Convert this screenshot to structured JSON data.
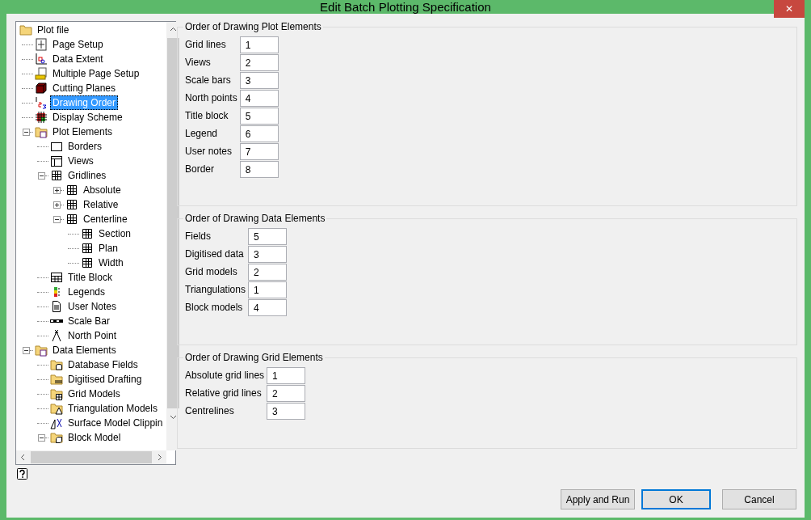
{
  "window": {
    "title": "Edit Batch Plotting Specification",
    "close": "✕"
  },
  "tree": {
    "items": [
      {
        "label": "Plot file",
        "kind": "folder",
        "selected": false,
        "children": [
          {
            "label": "Page Setup",
            "kind": "page",
            "selected": false
          },
          {
            "label": "Data Extent",
            "kind": "extent",
            "selected": false
          },
          {
            "label": "Multiple Page Setup",
            "kind": "multipage",
            "selected": false
          },
          {
            "label": "Cutting Planes",
            "kind": "cube",
            "selected": false
          },
          {
            "label": "Drawing Order",
            "kind": "order",
            "selected": true
          },
          {
            "label": "Display Scheme",
            "kind": "scheme",
            "selected": false
          },
          {
            "label": "Plot Elements",
            "kind": "folder-doc",
            "selected": false,
            "expanded": true,
            "children": [
              {
                "label": "Borders",
                "kind": "border",
                "selected": false
              },
              {
                "label": "Views",
                "kind": "views",
                "selected": false
              },
              {
                "label": "Gridlines",
                "kind": "grid",
                "selected": false,
                "expanded": true,
                "children": [
                  {
                    "label": "Absolute",
                    "kind": "grid",
                    "selected": false,
                    "expanded": false
                  },
                  {
                    "label": "Relative",
                    "kind": "grid",
                    "selected": false,
                    "expanded": false
                  },
                  {
                    "label": "Centerline",
                    "kind": "grid",
                    "selected": false,
                    "expanded": true,
                    "children": [
                      {
                        "label": "Section",
                        "kind": "grid",
                        "selected": false
                      },
                      {
                        "label": "Plan",
                        "kind": "grid",
                        "selected": false
                      },
                      {
                        "label": "Width",
                        "kind": "grid",
                        "selected": false
                      }
                    ]
                  }
                ]
              },
              {
                "label": "Title Block",
                "kind": "titleblock",
                "selected": false
              },
              {
                "label": "Legends",
                "kind": "legend",
                "selected": false
              },
              {
                "label": "User Notes",
                "kind": "notes",
                "selected": false
              },
              {
                "label": "Scale Bar",
                "kind": "scalebar",
                "selected": false
              },
              {
                "label": "North Point",
                "kind": "north",
                "selected": false
              }
            ]
          },
          {
            "label": "Data Elements",
            "kind": "folder-doc",
            "selected": false,
            "expanded": true,
            "children": [
              {
                "label": "Database Fields",
                "kind": "folder-db",
                "selected": false
              },
              {
                "label": "Digitised Drafting",
                "kind": "folder-draft",
                "selected": false
              },
              {
                "label": "Grid Models",
                "kind": "folder-grid",
                "selected": false
              },
              {
                "label": "Triangulation Models",
                "kind": "folder-tri",
                "selected": false
              },
              {
                "label": "Surface Model Clippin",
                "kind": "clip",
                "selected": false
              },
              {
                "label": "Block Model",
                "kind": "folder-block",
                "selected": false,
                "expanded": true
              }
            ]
          }
        ]
      }
    ]
  },
  "groups": [
    {
      "title": "Order of Drawing Plot Elements",
      "fields": [
        {
          "label": "Grid lines",
          "value": "1"
        },
        {
          "label": "Views",
          "value": "2"
        },
        {
          "label": "Scale bars",
          "value": "3"
        },
        {
          "label": "North points",
          "value": "4"
        },
        {
          "label": "Title block",
          "value": "5"
        },
        {
          "label": "Legend",
          "value": "6"
        },
        {
          "label": "User notes",
          "value": "7"
        },
        {
          "label": "Border",
          "value": "8"
        }
      ]
    },
    {
      "title": "Order of Drawing Data Elements",
      "fields": [
        {
          "label": "Fields",
          "value": "5"
        },
        {
          "label": "Digitised data",
          "value": "3"
        },
        {
          "label": "Grid models",
          "value": "2"
        },
        {
          "label": "Triangulations",
          "value": "1"
        },
        {
          "label": "Block models",
          "value": "4"
        }
      ]
    },
    {
      "title": "Order of Drawing Grid Elements",
      "fields": [
        {
          "label": "Absolute grid lines",
          "value": "1"
        },
        {
          "label": "Relative grid lines",
          "value": "2"
        },
        {
          "label": "Centrelines",
          "value": "3"
        }
      ]
    }
  ],
  "buttons": [
    {
      "label": "Apply and Run",
      "default": false
    },
    {
      "label": "OK",
      "default": true
    },
    {
      "label": "Cancel",
      "default": false
    }
  ]
}
